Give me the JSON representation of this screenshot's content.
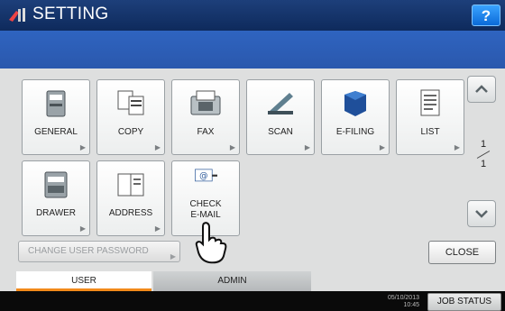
{
  "header": {
    "title": "SETTING",
    "help_label": "?",
    "title_icon": "settings-tools-icon"
  },
  "tiles": [
    {
      "label": "GENERAL",
      "icon": "general-icon"
    },
    {
      "label": "COPY",
      "icon": "copy-icon"
    },
    {
      "label": "FAX",
      "icon": "fax-icon"
    },
    {
      "label": "SCAN",
      "icon": "scan-icon"
    },
    {
      "label": "E-FILING",
      "icon": "e-filing-icon"
    },
    {
      "label": "LIST",
      "icon": "list-icon"
    },
    {
      "label": "DRAWER",
      "icon": "drawer-icon"
    },
    {
      "label": "ADDRESS",
      "icon": "address-icon"
    },
    {
      "label": "CHECK\nE-MAIL",
      "label_line1": "CHECK",
      "label_line2": "E-MAIL",
      "icon": "email-icon"
    }
  ],
  "pager": {
    "current": "1",
    "total": "1"
  },
  "buttons": {
    "change_password": "CHANGE USER PASSWORD",
    "close": "CLOSE"
  },
  "tabs": [
    {
      "label": "USER",
      "active": true
    },
    {
      "label": "ADMIN",
      "active": false
    }
  ],
  "status": {
    "date": "05/10/2013",
    "time": "10:45",
    "job_status": "JOB STATUS"
  },
  "colors": {
    "title_bar": "#0e2a5c",
    "accent_tab": "#f28a1a",
    "help": "#0b6ad8"
  }
}
